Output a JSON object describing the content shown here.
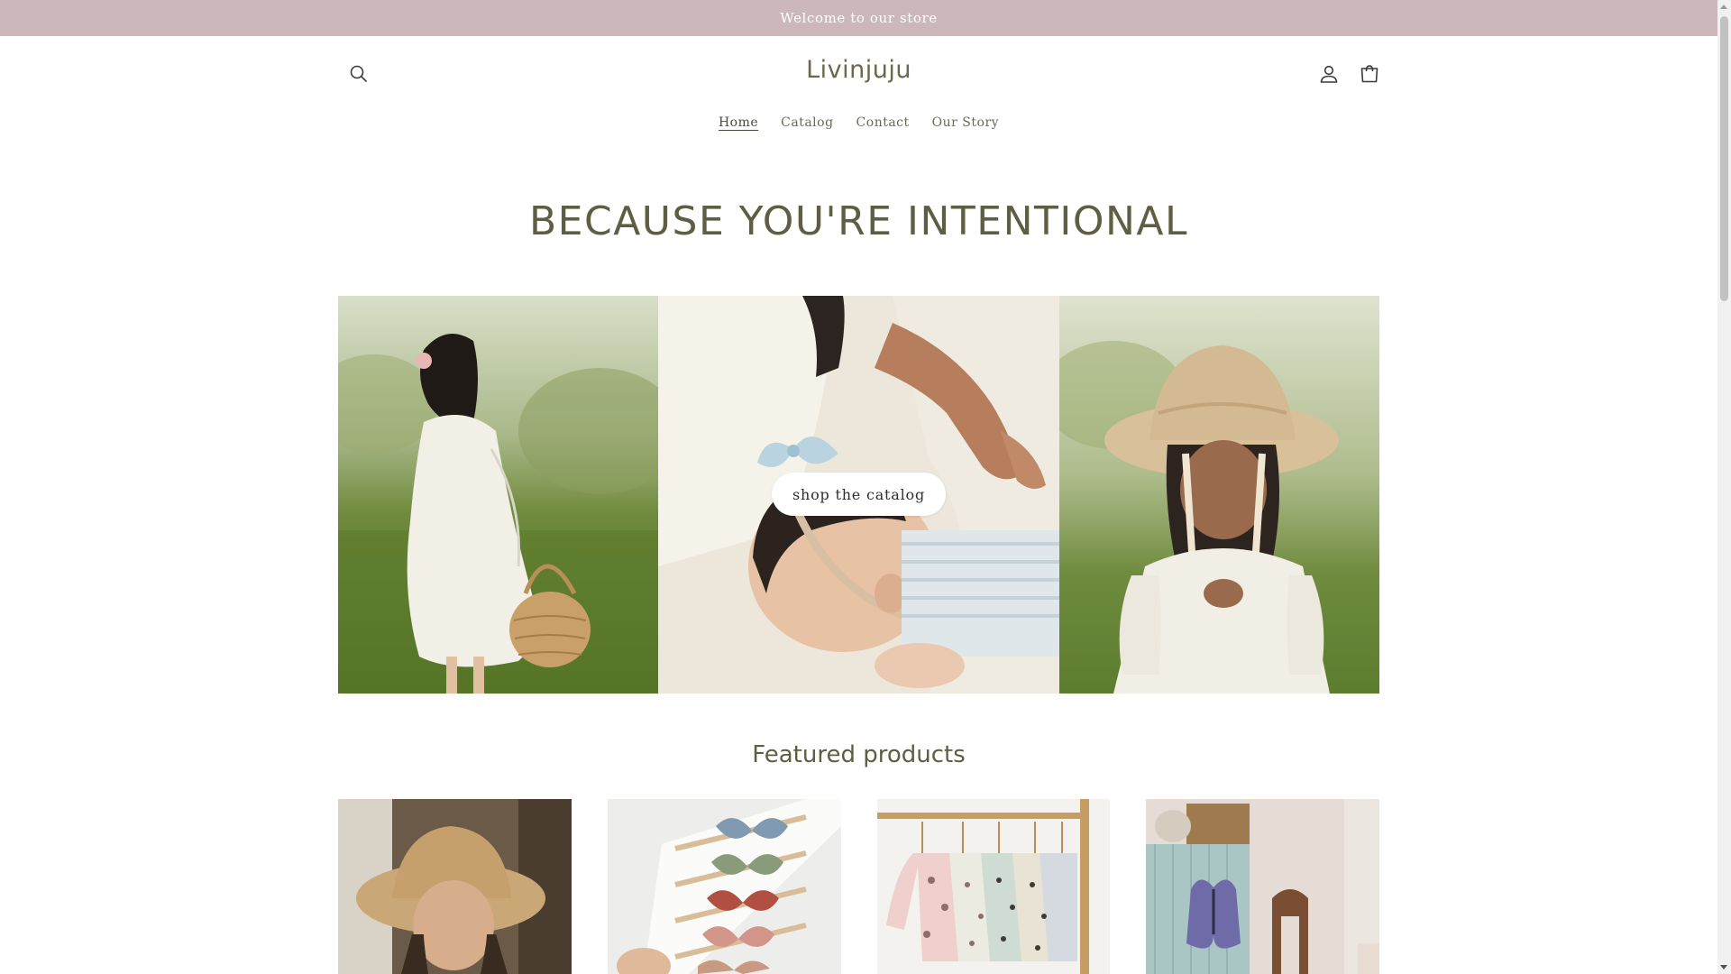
{
  "announcement": {
    "text": "Welcome to our store"
  },
  "header": {
    "logo": "Livinjuju",
    "icons": {
      "search": "search-icon",
      "account": "account-icon",
      "cart": "cart-icon"
    },
    "nav": [
      {
        "label": "Home",
        "active": true
      },
      {
        "label": "Catalog",
        "active": false
      },
      {
        "label": "Contact",
        "active": false
      },
      {
        "label": "Our Story",
        "active": false
      }
    ]
  },
  "hero": {
    "heading": "BECAUSE YOU'RE INTENTIONAL",
    "cta_label": "shop the catalog"
  },
  "featured": {
    "title": "Featured products",
    "products": [
      {
        "image": "girl-straw-hat-photo"
      },
      {
        "image": "hair-bows-photo"
      },
      {
        "image": "baby-sweatshirts-rack-photo"
      },
      {
        "image": "butterfly-wings-dresser-photo"
      }
    ]
  },
  "colors": {
    "announcement_bg": "#ccb8bc",
    "heading_olive": "#5e5e42",
    "text": "#4a4a3a"
  }
}
